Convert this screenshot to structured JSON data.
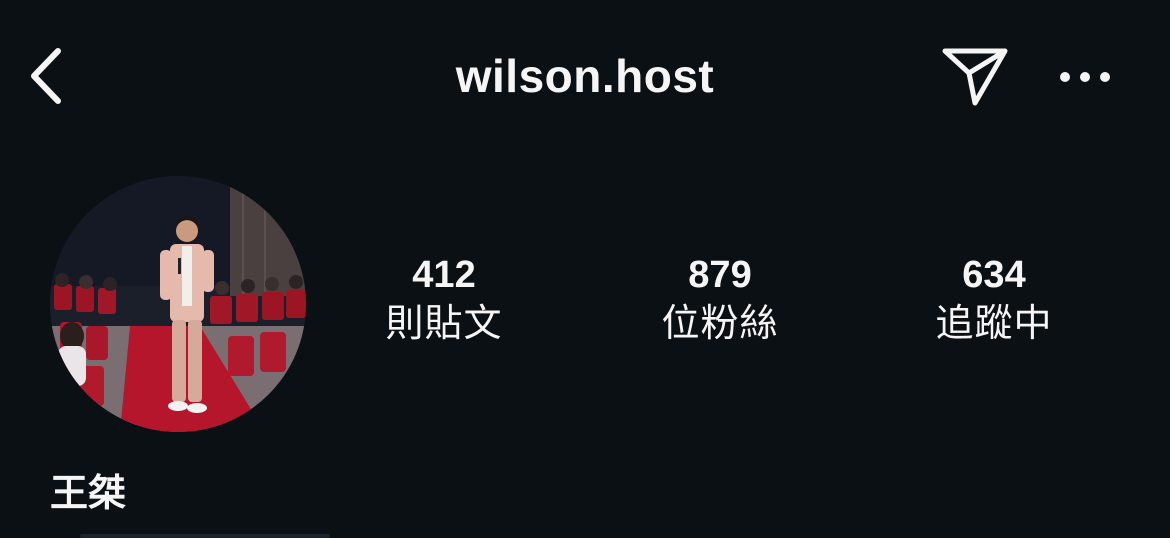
{
  "header": {
    "back_icon": "chevron-left-icon",
    "username": "wilson.host",
    "share_icon": "paper-plane-icon",
    "more_icon": "ellipsis-icon"
  },
  "profile": {
    "avatar_icon": "profile-photo",
    "display_name": "王桀"
  },
  "stats": [
    {
      "value": "412",
      "label": "則貼文"
    },
    {
      "value": "879",
      "label": "位粉絲"
    },
    {
      "value": "634",
      "label": "追蹤中"
    }
  ],
  "colors": {
    "background": "#0b1014",
    "text": "#f5f5f5",
    "accent_red": "#b5162b"
  }
}
